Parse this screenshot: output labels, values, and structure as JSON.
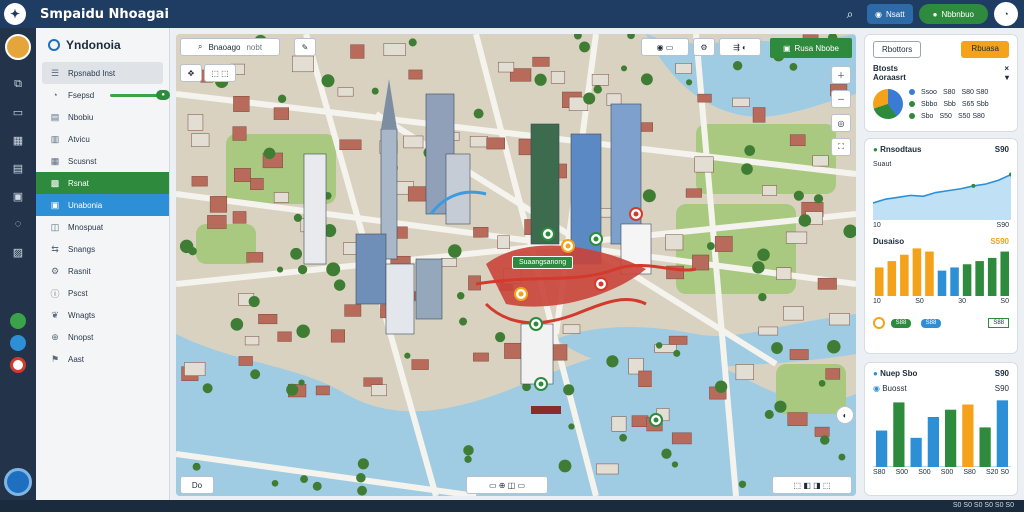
{
  "app": {
    "title": "Smpaidu Nhoagai",
    "logo_icon": "person-icon"
  },
  "topbar": {
    "search_icon": "search-icon",
    "pill_blue_label": "Nsatt",
    "pill_green_label": "Nbbnbuo",
    "account_icon": "profile-icon"
  },
  "sidebar": {
    "title": "Yndonoia",
    "items": [
      {
        "label": "Rpsnabd Inst",
        "icon": "list-icon",
        "state": "selected"
      },
      {
        "label": "Fsepsd",
        "icon": "progress-icon",
        "state": "progress"
      },
      {
        "label": "Nbobiu",
        "icon": "document-icon",
        "state": "normal"
      },
      {
        "label": "Atvicu",
        "icon": "chart-icon",
        "state": "normal"
      },
      {
        "label": "Scusnst",
        "icon": "building-icon",
        "state": "normal"
      },
      {
        "label": "Rsnat",
        "icon": "grid-icon",
        "state": "green"
      },
      {
        "label": "Unabonia",
        "icon": "map-icon",
        "state": "blue"
      },
      {
        "label": "Mnospuat",
        "icon": "layers-icon",
        "state": "normal"
      },
      {
        "label": "Snangs",
        "icon": "route-icon",
        "state": "normal"
      },
      {
        "label": "Rasnit",
        "icon": "settings-icon",
        "state": "normal"
      },
      {
        "label": "Pscst",
        "icon": "info-icon",
        "state": "normal"
      },
      {
        "label": "Wnagts",
        "icon": "leaf-icon",
        "state": "normal"
      },
      {
        "label": "Nnopst",
        "icon": "plus-icon",
        "state": "normal"
      },
      {
        "label": "Aast",
        "icon": "flag-icon",
        "state": "normal"
      }
    ]
  },
  "map": {
    "search_label": "Bnaoago",
    "search_suffix": "nobt",
    "green_button_label": "Rusa Nbobe",
    "marker_label": "Suaangsanong",
    "bottom_left_label": "Do",
    "colors": {
      "water": "#9fcbe3",
      "park": "#a8c97f",
      "roof": "#b86b5a",
      "road": "#f5f3ee",
      "route": "#d33a2c",
      "accent": "#2e8b3e"
    }
  },
  "panels": {
    "top": {
      "btn_outline": "Rbottors",
      "btn_orange": "Rbuasa",
      "line1": "Btosts",
      "line2": "Aoraasrt",
      "stats": [
        {
          "color": "#3a7bd5",
          "text": "Ssoo",
          "a": "S80",
          "b": "S80 S80"
        },
        {
          "color": "#2e8b3e",
          "text": "Sbbo",
          "a": "Sbb",
          "b": "S65 Sbb"
        },
        {
          "color": "#2e8b3e",
          "text": "Sbo",
          "a": "S50",
          "b": "S50 S80"
        }
      ]
    },
    "middle": {
      "title": "Rnsodtaus",
      "value": "S90",
      "sub1": "Suaut",
      "sub2": "Dusaiso",
      "sub2_val": "S590",
      "tick_left": "10",
      "tick_right": "S90",
      "line_chart": {
        "values": [
          18,
          22,
          24,
          26,
          25,
          29,
          31,
          33,
          36,
          38,
          42,
          48
        ]
      },
      "bar_chart": {
        "values": [
          18,
          22,
          26,
          30,
          28,
          16,
          18,
          20,
          22,
          24,
          28
        ],
        "colors": [
          "#f3a21a",
          "#f3a21a",
          "#f3a21a",
          "#f3a21a",
          "#f3a21a",
          "#2d8fd5",
          "#2d8fd5",
          "#2e8b3e",
          "#2e8b3e",
          "#2e8b3e",
          "#2e8b3e"
        ]
      },
      "bar_ticks": [
        "10",
        "S0",
        "30",
        "S0"
      ],
      "chip_green": "S88",
      "chip_blue": "S88",
      "chip_right": "S88"
    },
    "bottom": {
      "title": "Nuep Sbo",
      "value": "S90",
      "sub": "Buosst",
      "sub_val": "S90",
      "bars": {
        "values": [
          35,
          62,
          28,
          48,
          55,
          60,
          38,
          64
        ],
        "colors": [
          "#2d8fd5",
          "#2e8b3e",
          "#2d8fd5",
          "#2d8fd5",
          "#2e8b3e",
          "#f3a21a",
          "#2e8b3e",
          "#2d8fd5"
        ]
      },
      "ticks": [
        "S80",
        "S00",
        "S00",
        "S00",
        "S80",
        "S20 S0"
      ]
    }
  },
  "statusbar": {
    "text": "S0 S0 S0 S0 S0 S0"
  }
}
